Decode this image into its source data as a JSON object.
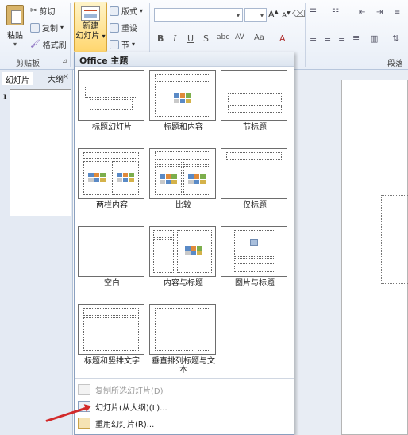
{
  "ribbon": {
    "clipboard": {
      "paste": "粘贴",
      "cut": "剪切",
      "copy": "复制",
      "format_painter": "格式刷",
      "group_label": "剪贴板"
    },
    "slides": {
      "new_slide": "新建",
      "new_slide_line2": "幻灯片",
      "layout": "版式",
      "reset": "重设",
      "section": "节"
    },
    "paragraph_label": "段落"
  },
  "left_pane": {
    "tabs": [
      "幻灯片",
      "大纲"
    ],
    "close": "×",
    "slide_number": "1"
  },
  "gallery": {
    "header": "Office 主题",
    "layouts": [
      {
        "label": "标题幻灯片"
      },
      {
        "label": "标题和内容"
      },
      {
        "label": "节标题"
      },
      {
        "label": "两栏内容"
      },
      {
        "label": "比较"
      },
      {
        "label": "仅标题"
      },
      {
        "label": "空白"
      },
      {
        "label": "内容与标题"
      },
      {
        "label": "图片与标题"
      },
      {
        "label": "标题和竖排文字"
      },
      {
        "label": "垂直排列标题与文本"
      }
    ],
    "menu": {
      "duplicate": "复制所选幻灯片(D)",
      "from_outline": "幻灯片(从大纲)(L)...",
      "reuse": "重用幻灯片(R)..."
    }
  },
  "colors": {
    "accent": "#ffd66e",
    "annotation_arrow": "#d22a2a"
  }
}
